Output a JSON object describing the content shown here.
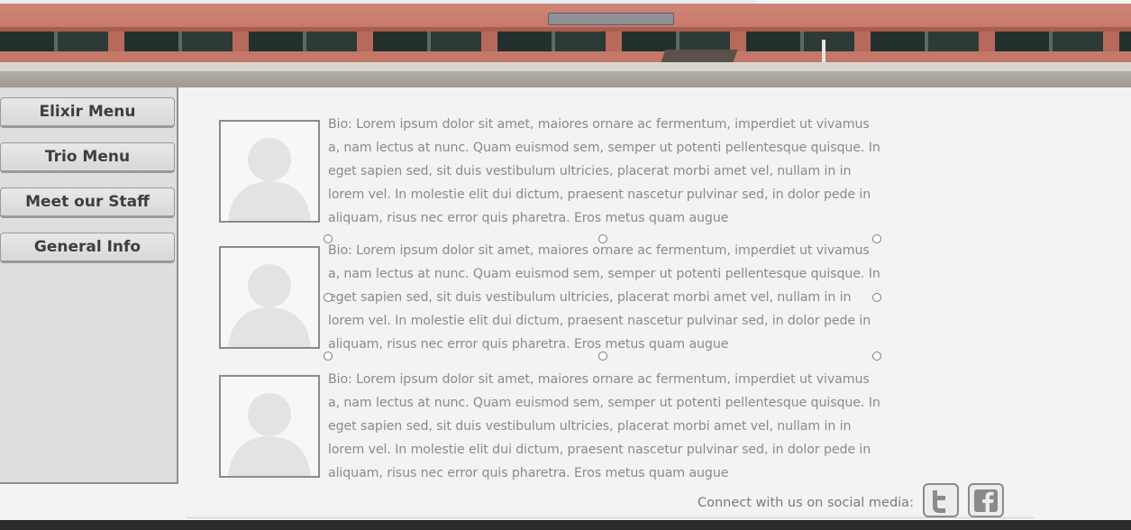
{
  "banner": {
    "image": "cafe-storefront-photo"
  },
  "sidebar": {
    "items": [
      {
        "label": "Elixir Menu"
      },
      {
        "label": "Trio Menu"
      },
      {
        "label": "Meet our Staff"
      },
      {
        "label": "General Info"
      }
    ]
  },
  "staff": [
    {
      "bio": "Bio: Lorem ipsum dolor sit amet, maiores ornare ac fermentum, imperdiet ut vivamus a, nam lectus at nunc. Quam euismod sem, semper ut potenti pellentesque quisque. In eget sapien sed, sit duis vestibulum ultricies, placerat morbi amet vel, nullam in in lorem vel. In molestie elit dui dictum, praesent nascetur pulvinar sed, in dolor pede in aliquam, risus nec error quis pharetra. Eros metus quam augue",
      "photo": "person-placeholder-icon"
    },
    {
      "bio": "Bio: Lorem ipsum dolor sit amet, maiores ornare ac fermentum, imperdiet ut vivamus a, nam lectus at nunc. Quam euismod sem, semper ut potenti pellentesque quisque. In eget sapien sed, sit duis vestibulum ultricies, placerat morbi amet vel, nullam in in lorem vel. In molestie elit dui dictum, praesent nascetur pulvinar sed, in dolor pede in aliquam, risus nec error quis pharetra. Eros metus quam augue",
      "photo": "person-placeholder-icon"
    },
    {
      "bio": "Bio: Lorem ipsum dolor sit amet, maiores ornare ac fermentum, imperdiet ut vivamus a, nam lectus at nunc. Quam euismod sem, semper ut potenti pellentesque quisque. In eget sapien sed, sit duis vestibulum ultricies, placerat morbi amet vel, nullam in in lorem vel. In molestie elit dui dictum, praesent nascetur pulvinar sed, in dolor pede in aliquam, risus nec error quis pharetra. Eros metus quam augue",
      "photo": "person-placeholder-icon"
    }
  ],
  "social": {
    "label": "Connect with us on social media:",
    "icons": [
      "twitter-icon",
      "facebook-icon"
    ]
  },
  "colors": {
    "sidebar_bg": "#dedede",
    "text_gray": "#8a8a8a",
    "nav_text": "#3e3e3e",
    "footer": "#2c2c2c"
  }
}
